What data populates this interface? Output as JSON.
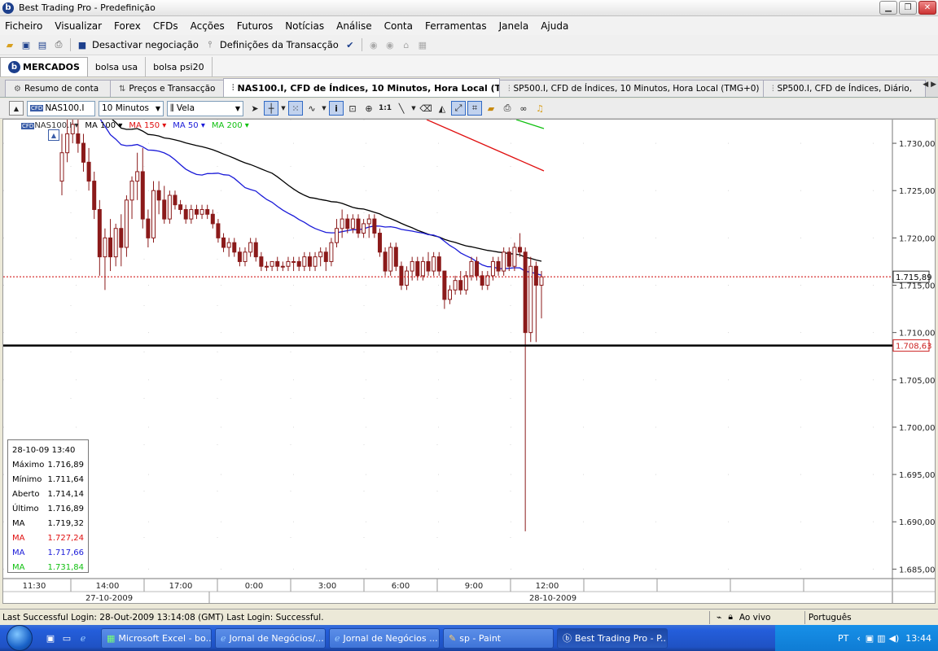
{
  "window": {
    "title": "Best Trading Pro - Predefinição",
    "app_icon_letter": "b"
  },
  "menu": [
    "Ficheiro",
    "Visualizar",
    "Forex",
    "CFDs",
    "Acções",
    "Futuros",
    "Notícias",
    "Análise",
    "Conta",
    "Ferramentas",
    "Janela",
    "Ajuda"
  ],
  "toolbar1": {
    "deactivate_label": "Desactivar negociação",
    "definitions_label": "Definições da Transacção"
  },
  "market_tabs": [
    "MERCADOS",
    "bolsa usa",
    "bolsa psi20"
  ],
  "doc_tabs": [
    "Resumo de conta",
    "Preços e Transacção",
    "NAS100.I, CFD de Índices, 10 Minutos, Hora Local (TMG+0)",
    "SP500.I, CFD de Índices, 10 Minutos, Hora Local (TMG+0)",
    "SP500.I, CFD de Índices, Diário,"
  ],
  "chart_toolbar": {
    "symbol": "NAS100.I",
    "timeframe": "10 Minutos",
    "chart_style": "Vela"
  },
  "indicator_legend": {
    "symbol": "NAS100.I",
    "ma100": "MA 100",
    "ma150": "MA 150",
    "ma50": "MA 50",
    "ma200": "MA 200"
  },
  "colors": {
    "ma100": "#000000",
    "ma150": "#e01010",
    "ma50": "#1a1ad8",
    "ma200": "#10c010",
    "candle": "#8b1a1a",
    "price_line": "#cc0000"
  },
  "chart_data": {
    "type": "candlestick",
    "symbol": "NAS100.I",
    "timeframe": "10 Minutos",
    "y_ticks": [
      "1.730,00",
      "1.725,00",
      "1.720,00",
      "1.715,00",
      "1.710,00",
      "1.705,00",
      "1.700,00",
      "1.695,00",
      "1.690,00",
      "1.685,00"
    ],
    "ylim": [
      1684,
      1732.5
    ],
    "x_ticks": [
      "11:30",
      "14:00",
      "17:00",
      "0:00",
      "3:00",
      "6:00",
      "9:00",
      "12:00"
    ],
    "date_labels": [
      "27-10-2009",
      "28-10-2009"
    ],
    "current_price": {
      "value": 1715.89,
      "label": "1.715,89"
    },
    "horizontal_line": {
      "value": 1708.63,
      "label": "1.708,63"
    },
    "candles": [
      [
        1726,
        1731,
        1724.5,
        1729
      ],
      [
        1729,
        1733,
        1728,
        1731
      ],
      [
        1731,
        1733,
        1730,
        1732
      ],
      [
        1731,
        1732.5,
        1729,
        1730
      ],
      [
        1730,
        1731,
        1727,
        1728
      ],
      [
        1728,
        1729.5,
        1725,
        1726
      ],
      [
        1726,
        1727,
        1722,
        1723
      ],
      [
        1723,
        1724,
        1716,
        1718
      ],
      [
        1718,
        1721,
        1714.5,
        1720
      ],
      [
        1720,
        1722,
        1716.5,
        1718
      ],
      [
        1718,
        1721.5,
        1717,
        1721
      ],
      [
        1721,
        1722.5,
        1717,
        1719
      ],
      [
        1719,
        1724.5,
        1718,
        1724
      ],
      [
        1724,
        1726.5,
        1722,
        1726
      ],
      [
        1726,
        1729,
        1724,
        1727
      ],
      [
        1727,
        1729.5,
        1721,
        1722
      ],
      [
        1722,
        1723,
        1719,
        1720
      ],
      [
        1720,
        1726,
        1719.5,
        1725
      ],
      [
        1725,
        1726,
        1722.5,
        1724
      ],
      [
        1724,
        1725.5,
        1721.5,
        1722
      ],
      [
        1722,
        1725,
        1721.5,
        1724.5
      ],
      [
        1724.5,
        1725,
        1723,
        1723.5
      ],
      [
        1723.5,
        1724,
        1722.5,
        1723
      ],
      [
        1723,
        1723.5,
        1721.5,
        1722
      ],
      [
        1722,
        1723.5,
        1721.5,
        1723
      ],
      [
        1723,
        1723.5,
        1722,
        1722.5
      ],
      [
        1722.5,
        1723.5,
        1722,
        1723
      ],
      [
        1723,
        1723.5,
        1722,
        1722.5
      ],
      [
        1722.5,
        1723,
        1721,
        1721.5
      ],
      [
        1721.5,
        1722,
        1719.5,
        1720
      ],
      [
        1720,
        1720.5,
        1718.5,
        1719
      ],
      [
        1719,
        1720,
        1718,
        1719.5
      ],
      [
        1719.5,
        1720,
        1718,
        1718.5
      ],
      [
        1718.5,
        1719,
        1717,
        1717.5
      ],
      [
        1717.5,
        1719,
        1717,
        1718.5
      ],
      [
        1718.5,
        1720,
        1718,
        1719.5
      ],
      [
        1719.5,
        1720,
        1717.5,
        1718
      ],
      [
        1718,
        1718.5,
        1716.5,
        1717
      ],
      [
        1717,
        1717.5,
        1716.5,
        1717
      ],
      [
        1717,
        1717.5,
        1716.5,
        1717.5
      ],
      [
        1717.5,
        1718,
        1716.5,
        1717
      ],
      [
        1717,
        1717.5,
        1716.5,
        1717
      ],
      [
        1717,
        1718,
        1716.5,
        1717.5
      ],
      [
        1717.5,
        1718,
        1716.5,
        1717.5
      ],
      [
        1717.5,
        1718,
        1716.5,
        1717
      ],
      [
        1717,
        1718.5,
        1716.5,
        1718
      ],
      [
        1718,
        1718.5,
        1716.5,
        1717
      ],
      [
        1717,
        1718.5,
        1716.5,
        1718
      ],
      [
        1718,
        1719,
        1717,
        1718.5
      ],
      [
        1718.5,
        1719,
        1716.5,
        1717.5
      ],
      [
        1717.5,
        1720,
        1717,
        1719.5
      ],
      [
        1719.5,
        1722,
        1719,
        1721
      ],
      [
        1721,
        1723,
        1720,
        1722
      ],
      [
        1722,
        1722.5,
        1720.5,
        1721
      ],
      [
        1721,
        1722.5,
        1720.5,
        1722
      ],
      [
        1722,
        1722.5,
        1720,
        1720.5
      ],
      [
        1720.5,
        1722,
        1720,
        1721.5
      ],
      [
        1721.5,
        1722.5,
        1720,
        1722
      ],
      [
        1722,
        1722.5,
        1720,
        1720.5
      ],
      [
        1720.5,
        1721,
        1718,
        1718.5
      ],
      [
        1718.5,
        1719,
        1716,
        1716.5
      ],
      [
        1716.5,
        1719.5,
        1716,
        1719
      ],
      [
        1719,
        1719.5,
        1716.5,
        1717
      ],
      [
        1717,
        1717.5,
        1714.5,
        1715
      ],
      [
        1715,
        1717,
        1714.5,
        1716.5
      ],
      [
        1716.5,
        1718,
        1715.5,
        1717.5
      ],
      [
        1717.5,
        1718,
        1715.5,
        1716
      ],
      [
        1716,
        1718,
        1715.5,
        1717.5
      ],
      [
        1717.5,
        1718.5,
        1716,
        1716.5
      ],
      [
        1716.5,
        1718.5,
        1716,
        1718
      ],
      [
        1718,
        1718.5,
        1716,
        1716.5
      ],
      [
        1716.5,
        1716.5,
        1712.5,
        1713.5
      ],
      [
        1713.5,
        1715,
        1713,
        1714.5
      ],
      [
        1714.5,
        1716,
        1714,
        1715.5
      ],
      [
        1715.5,
        1716.5,
        1714,
        1714.5
      ],
      [
        1714.5,
        1716.5,
        1714,
        1716
      ],
      [
        1716,
        1718,
        1715.5,
        1717.5
      ],
      [
        1717.5,
        1718,
        1715.5,
        1716
      ],
      [
        1716,
        1716.5,
        1714.5,
        1715
      ],
      [
        1715,
        1716.5,
        1714.5,
        1716
      ],
      [
        1716,
        1718,
        1715.5,
        1717.5
      ],
      [
        1717.5,
        1718,
        1716,
        1716.5
      ],
      [
        1716.5,
        1719,
        1716,
        1718.5
      ],
      [
        1718.5,
        1719,
        1716.5,
        1717
      ],
      [
        1717,
        1719.5,
        1716.5,
        1719
      ],
      [
        1719,
        1720.5,
        1718,
        1718.5
      ],
      [
        1718.5,
        1719,
        1689,
        1710
      ],
      [
        1710,
        1718,
        1709,
        1717
      ],
      [
        1717,
        1717.5,
        1709,
        1715
      ],
      [
        1715,
        1716.5,
        1711.5,
        1715.89
      ]
    ]
  },
  "data_panel": {
    "datetime": "28-10-09  13:40",
    "rows": [
      {
        "label": "Máximo",
        "value": "1.716,89",
        "color": "#000000"
      },
      {
        "label": "Mínimo",
        "value": "1.711,64",
        "color": "#000000"
      },
      {
        "label": "Aberto",
        "value": "1.714,14",
        "color": "#000000"
      },
      {
        "label": "Último",
        "value": "1.716,89",
        "color": "#000000"
      },
      {
        "label": "MA",
        "value": "1.719,32",
        "color": "#000000"
      },
      {
        "label": "MA",
        "value": "1.727,24",
        "color": "#e01010"
      },
      {
        "label": "MA",
        "value": "1.717,66",
        "color": "#1a1ad8"
      },
      {
        "label": "MA",
        "value": "1.731,84",
        "color": "#10c010"
      }
    ]
  },
  "status_bar": {
    "login_text": "Last Successful Login: 28-Out-2009 13:14:08 (GMT)  Last Login: Successful.",
    "mode": "Ao vivo",
    "language": "Português"
  },
  "taskbar": {
    "tasks": [
      "Microsoft Excel - bo...",
      "Jornal de Negócios/...",
      "Jornal de Negócios ...",
      "sp - Paint",
      "Best Trading Pro - P..."
    ],
    "language": "PT",
    "time": "13:44"
  }
}
